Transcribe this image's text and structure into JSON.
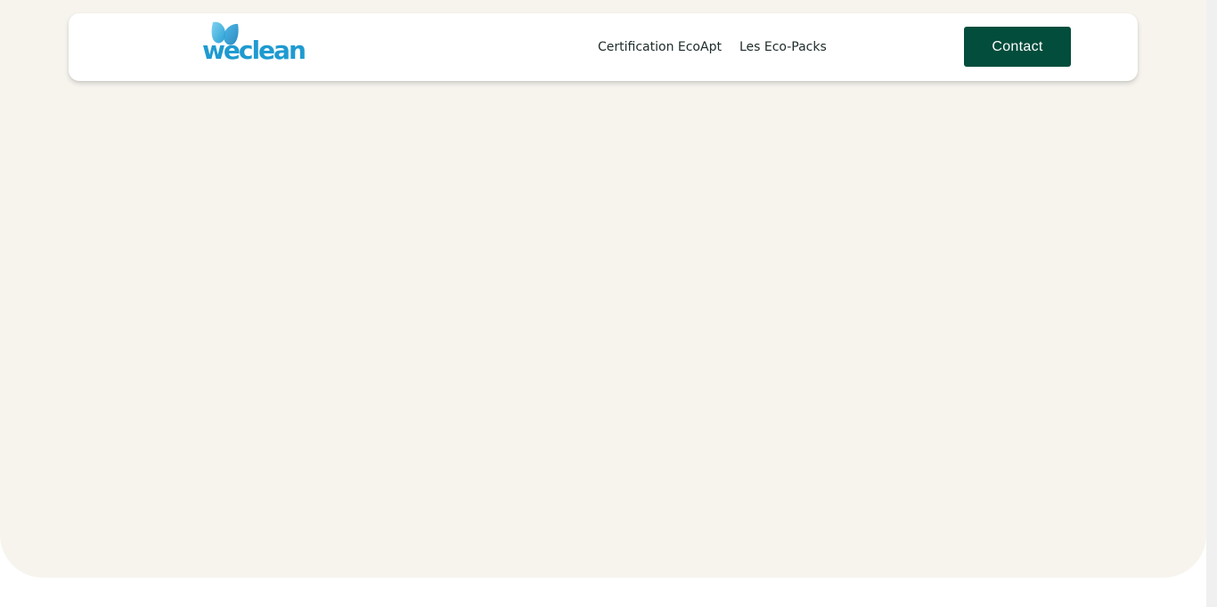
{
  "brand": {
    "logo_text": "weclean",
    "logo_icon": "water-drop-icon",
    "logo_color": "#1f9ad0"
  },
  "nav": {
    "links": [
      {
        "label": "Certification EcoApt"
      },
      {
        "label": "Les Eco-Packs"
      }
    ],
    "contact_label": "Contact"
  },
  "colors": {
    "hero_background": "#f7f4ee",
    "contact_button": "#034d3c",
    "nav_text": "#1e2a2a"
  }
}
